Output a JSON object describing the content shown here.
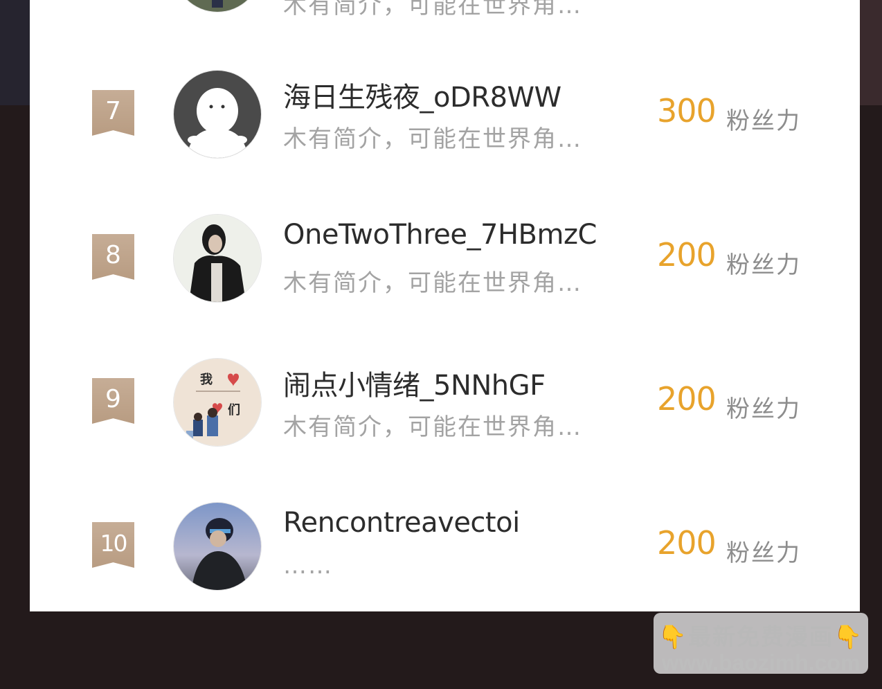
{
  "partial_row": {
    "bio": "木有简介，可能在世界角…"
  },
  "rows": [
    {
      "rank": "7",
      "name": "海日生残夜_oDR8WW",
      "bio": "木有简介，可能在世界角…",
      "score": "300",
      "unit": "粉丝力"
    },
    {
      "rank": "8",
      "name": "OneTwoThree_7HBmzC",
      "bio": "木有简介，可能在世界角…",
      "score": "200",
      "unit": "粉丝力"
    },
    {
      "rank": "9",
      "name": "闹点小情绪_5NNhGF",
      "bio": "木有简介，可能在世界角…",
      "score": "200",
      "unit": "粉丝力"
    },
    {
      "rank": "10",
      "name": "Rencontreavectoi",
      "bio": "……",
      "score": "200",
      "unit": "粉丝力"
    }
  ],
  "avatar_9_text": {
    "top": "我",
    "bottom": "们"
  },
  "watermark": {
    "line1": "最新免费漫画",
    "line2": "www.baozimh.com",
    "hand": "👇"
  },
  "colors": {
    "score": "#e8a32c",
    "badge": "#c0a58c",
    "name": "#2c2c2c",
    "bio": "#a3a3a3",
    "unit": "#8d8d8d"
  }
}
